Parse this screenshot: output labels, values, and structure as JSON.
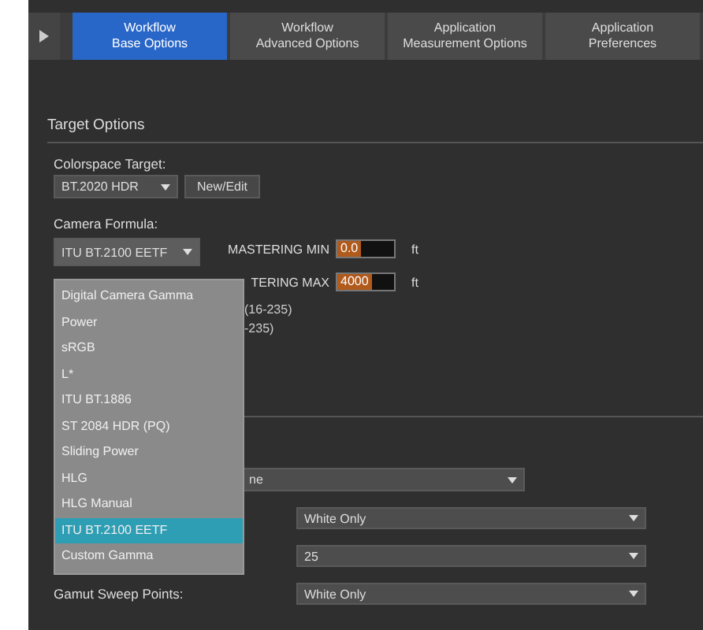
{
  "tabs": [
    {
      "label": "Workflow\nBase Options",
      "selected": true
    },
    {
      "label": "Workflow\nAdvanced Options",
      "selected": false
    },
    {
      "label": "Application\nMeasurement Options",
      "selected": false
    },
    {
      "label": "Application\nPreferences",
      "selected": false
    }
  ],
  "section_title": "Target Options",
  "colorspace": {
    "label": "Colorspace Target:",
    "value": "BT.2020 HDR",
    "button": "New/Edit"
  },
  "camera": {
    "label": "Camera Formula:",
    "value": "ITU BT.2100 EETF",
    "expanded": true
  },
  "mastering": [
    {
      "label": "MASTERING MIN",
      "value": "0.0",
      "unit": "ft"
    },
    {
      "label": "TERING MAX",
      "value": "4000",
      "unit": "ft"
    }
  ],
  "hidden_texts": [
    "(16-235)",
    "-235)"
  ],
  "formula_options": [
    {
      "label": "Digital Camera Gamma",
      "selected": false
    },
    {
      "label": "Power",
      "selected": false
    },
    {
      "label": "sRGB",
      "selected": false
    },
    {
      "label": "L*",
      "selected": false
    },
    {
      "label": "ITU BT.1886",
      "selected": false
    },
    {
      "label": "ST 2084 HDR (PQ)",
      "selected": false
    },
    {
      "label": "Sliding Power",
      "selected": false
    },
    {
      "label": "HLG",
      "selected": false
    },
    {
      "label": "HLG Manual",
      "selected": false
    },
    {
      "label": "ITU BT.2100 EETF",
      "selected": true
    },
    {
      "label": "Custom Gamma",
      "selected": false
    }
  ],
  "wide_select": {
    "value": "ne"
  },
  "rows": [
    {
      "value": "White Only"
    },
    {
      "value": "25"
    },
    {
      "label": "Gamut Sweep Points:",
      "value": "White Only"
    }
  ]
}
